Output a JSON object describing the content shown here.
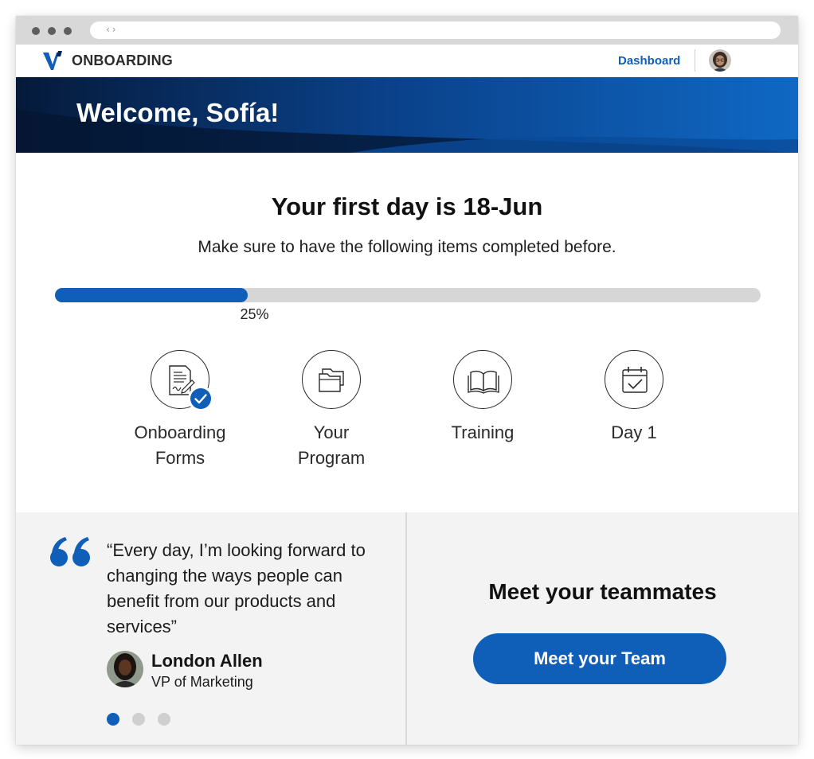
{
  "app": {
    "title": "ONBOARDING"
  },
  "nav": {
    "dashboard_label": "Dashboard"
  },
  "banner": {
    "welcome": "Welcome, Sofía!"
  },
  "main": {
    "heading": "Your first day is 18-Jun",
    "subheading": "Make sure to have the following items completed before.",
    "progress": {
      "percent": 25,
      "label": "25%"
    },
    "steps": [
      {
        "label": "Onboarding Forms",
        "icon": "document-signature-icon",
        "completed": true
      },
      {
        "label": "Your Program",
        "icon": "folders-icon",
        "completed": false
      },
      {
        "label": "Training",
        "icon": "open-book-icon",
        "completed": false
      },
      {
        "label": "Day 1",
        "icon": "calendar-check-icon",
        "completed": false
      }
    ]
  },
  "testimonial": {
    "quote": "“Every day, I’m looking forward to changing the ways people can benefit from our products and services”",
    "name": "London Allen",
    "role": "VP of Marketing",
    "slides": 3,
    "active_slide": 0
  },
  "teammates": {
    "heading": "Meet your teammates",
    "button_label": "Meet your Team"
  },
  "colors": {
    "brand_blue": "#0f5fb8",
    "banner_dark": "#06244f",
    "panel_bg": "#f3f3f3",
    "track_gray": "#d6d6d6"
  }
}
